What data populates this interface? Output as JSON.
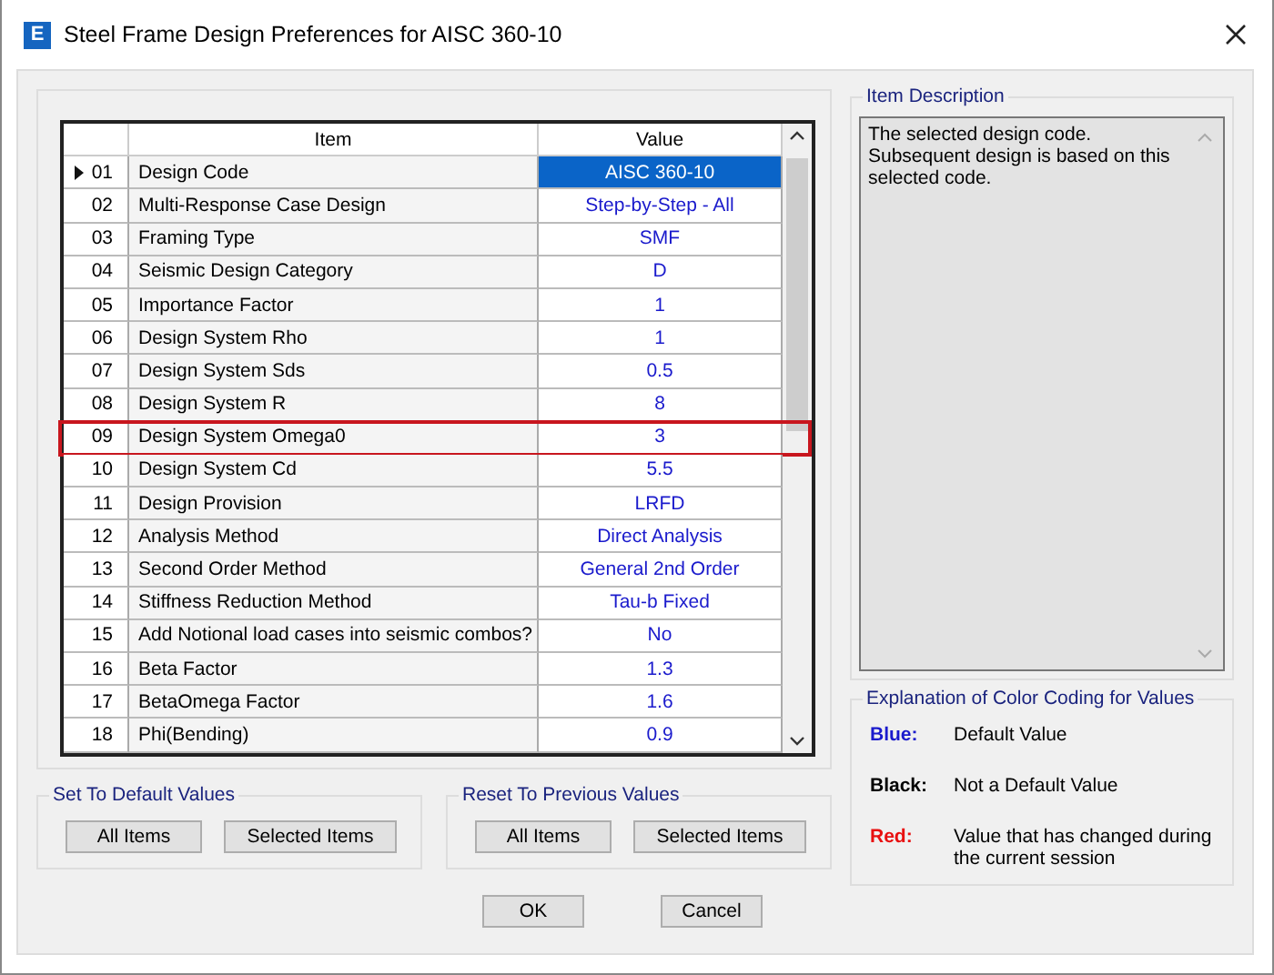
{
  "window": {
    "title": "Steel Frame Design Preferences for AISC 360-10",
    "app_letter": "E"
  },
  "table": {
    "columns": [
      "Item",
      "Value"
    ],
    "rows": [
      {
        "number": "01",
        "item": "Design Code",
        "value": "AISC 360-10",
        "selected": true,
        "highlighted": false
      },
      {
        "number": "02",
        "item": "Multi-Response Case Design",
        "value": "Step-by-Step - All",
        "selected": false,
        "highlighted": false
      },
      {
        "number": "03",
        "item": "Framing Type",
        "value": "SMF",
        "selected": false,
        "highlighted": false
      },
      {
        "number": "04",
        "item": "Seismic Design Category",
        "value": "D",
        "selected": false,
        "highlighted": false
      },
      {
        "number": "05",
        "item": "Importance Factor",
        "value": "1",
        "selected": false,
        "highlighted": false
      },
      {
        "number": "06",
        "item": "Design System Rho",
        "value": "1",
        "selected": false,
        "highlighted": false
      },
      {
        "number": "07",
        "item": "Design System Sds",
        "value": "0.5",
        "selected": false,
        "highlighted": false
      },
      {
        "number": "08",
        "item": "Design System R",
        "value": "8",
        "selected": false,
        "highlighted": false
      },
      {
        "number": "09",
        "item": "Design System Omega0",
        "value": "3",
        "selected": false,
        "highlighted": true
      },
      {
        "number": "10",
        "item": "Design System Cd",
        "value": "5.5",
        "selected": false,
        "highlighted": false
      },
      {
        "number": "11",
        "item": "Design Provision",
        "value": "LRFD",
        "selected": false,
        "highlighted": false
      },
      {
        "number": "12",
        "item": "Analysis Method",
        "value": "Direct Analysis",
        "selected": false,
        "highlighted": false
      },
      {
        "number": "13",
        "item": "Second Order Method",
        "value": "General 2nd Order",
        "selected": false,
        "highlighted": false
      },
      {
        "number": "14",
        "item": "Stiffness Reduction Method",
        "value": "Tau-b Fixed",
        "selected": false,
        "highlighted": false
      },
      {
        "number": "15",
        "item": "Add Notional load cases into seismic combos?",
        "value": "No",
        "selected": false,
        "highlighted": false
      },
      {
        "number": "16",
        "item": "Beta Factor",
        "value": "1.3",
        "selected": false,
        "highlighted": false
      },
      {
        "number": "17",
        "item": "BetaOmega Factor",
        "value": "1.6",
        "selected": false,
        "highlighted": false
      },
      {
        "number": "18",
        "item": "Phi(Bending)",
        "value": "0.9",
        "selected": false,
        "highlighted": false
      }
    ]
  },
  "item_description": {
    "title": "Item Description",
    "text": "The selected design code.\nSubsequent design is based on this selected code."
  },
  "color_coding": {
    "title": "Explanation of Color Coding for Values",
    "items": [
      {
        "label": "Blue:",
        "description": "Default Value",
        "color": "#1a1acc"
      },
      {
        "label": "Black:",
        "description": "Not a Default Value",
        "color": "#000000"
      },
      {
        "label": "Red:",
        "description": "Value that has changed during the current session",
        "color": "#e81010"
      }
    ]
  },
  "groups": [
    {
      "title": "Set To Default Values",
      "buttons": [
        "All Items",
        "Selected Items"
      ]
    },
    {
      "title": "Reset To Previous Values",
      "buttons": [
        "All Items",
        "Selected Items"
      ]
    }
  ],
  "buttons": [
    "OK",
    "Cancel"
  ]
}
